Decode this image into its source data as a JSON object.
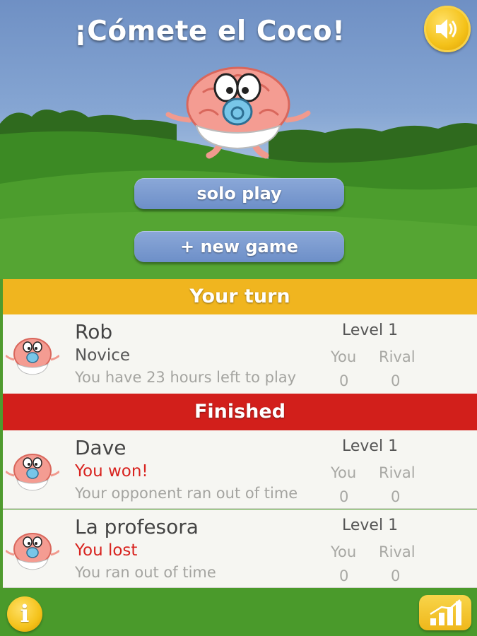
{
  "app": {
    "title": "¡Cómete el Coco!"
  },
  "menu": {
    "solo_play_label": "solo play",
    "new_game_label": "+ new game"
  },
  "sections": {
    "your_turn_label": "Your turn",
    "finished_label": "Finished"
  },
  "games": {
    "your_turn": [
      {
        "opponent": "Rob",
        "status": "Novice",
        "detail": "You have 23 hours left to play",
        "level": "Level 1",
        "you_label": "You",
        "rival_label": "Rival",
        "you_score": "0",
        "rival_score": "0"
      }
    ],
    "finished": [
      {
        "opponent": "Dave",
        "status": "You won!",
        "detail": "Your opponent ran out of time",
        "level": "Level 1",
        "you_label": "You",
        "rival_label": "Rival",
        "you_score": "0",
        "rival_score": "0"
      },
      {
        "opponent": "La profesora",
        "status": "You lost",
        "detail": "You ran out of time",
        "level": "Level 1",
        "you_label": "You",
        "rival_label": "Rival",
        "you_score": "0",
        "rival_score": "0"
      }
    ]
  },
  "bottom_bar": {
    "info_label": "i",
    "info_icon": "info-icon",
    "stats_icon": "bar-chart-icon",
    "sound_icon": "speaker-icon"
  },
  "colors": {
    "your_turn_header": "#f0b51f",
    "finished_header": "#d21f1b",
    "button_blue": "#7797cf",
    "accent_gold": "#f4c21a",
    "grass_green": "#4a9a2b",
    "won_lost_text": "#d8231f"
  }
}
